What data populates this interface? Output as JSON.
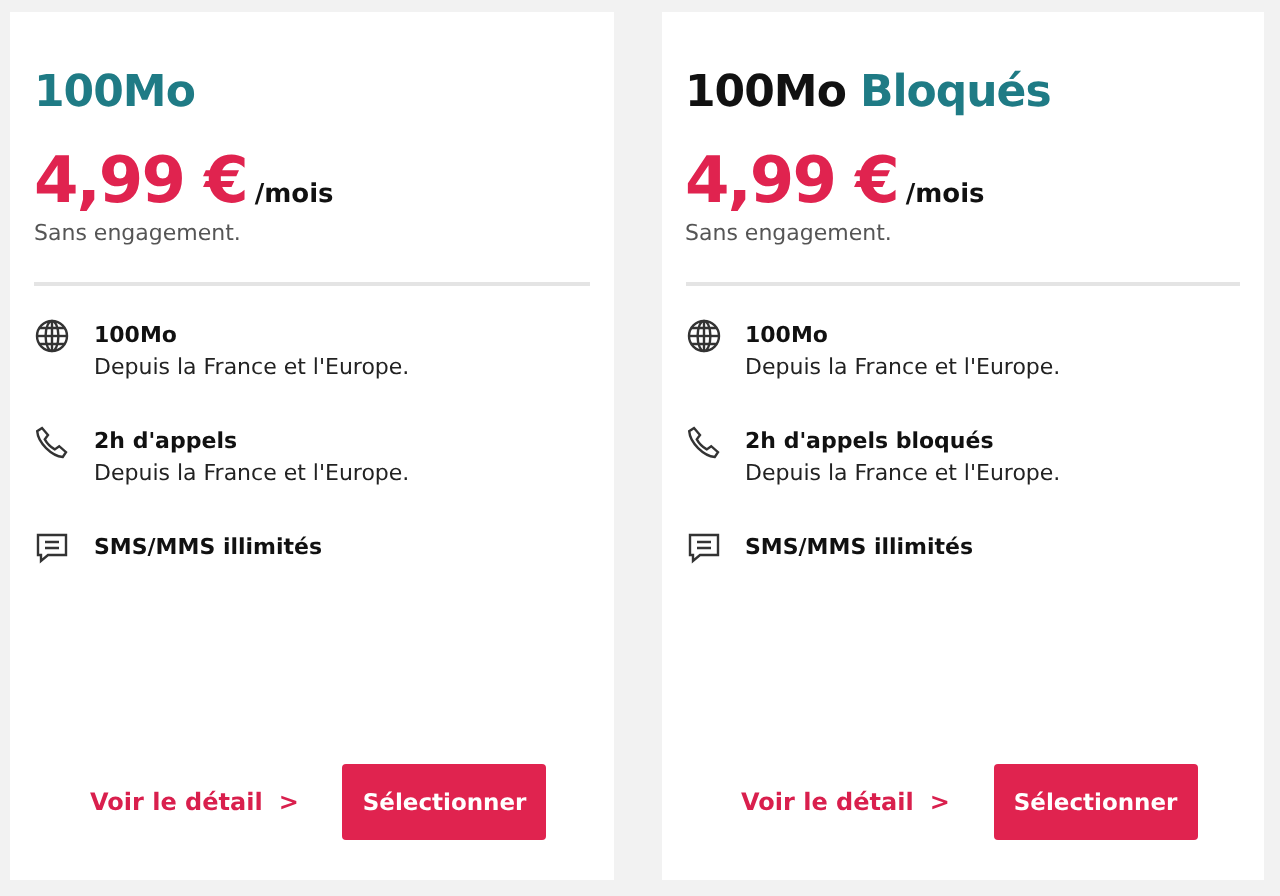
{
  "plans": [
    {
      "title": [
        {
          "text": "100Mo",
          "kind": "accent"
        }
      ],
      "price": "4,99 €",
      "period": "/mois",
      "note": "Sans engagement.",
      "features": [
        {
          "kind": "globe",
          "title": "100Mo",
          "detail": "Depuis la France et l'Europe."
        },
        {
          "kind": "phone",
          "title": "2h d'appels",
          "detail": "Depuis la France et l'Europe."
        },
        {
          "kind": "message",
          "title": "SMS/MMS illimités"
        }
      ],
      "link": "Voir le détail",
      "link_arrow": ">",
      "button": "Sélectionner"
    },
    {
      "title": [
        {
          "text": "100Mo",
          "kind": "plain"
        },
        {
          "text": "Bloqués",
          "kind": "accent"
        }
      ],
      "price": "4,99 €",
      "period": "/mois",
      "note": "Sans engagement.",
      "features": [
        {
          "kind": "globe",
          "title": "100Mo",
          "detail": "Depuis la France et l'Europe."
        },
        {
          "kind": "phone",
          "title": "2h d'appels bloqués",
          "detail": "Depuis la France et l'Europe."
        },
        {
          "kind": "message",
          "title": "SMS/MMS illimités"
        }
      ],
      "link": "Voir le détail",
      "link_arrow": ">",
      "button": "Sélectionner"
    }
  ]
}
